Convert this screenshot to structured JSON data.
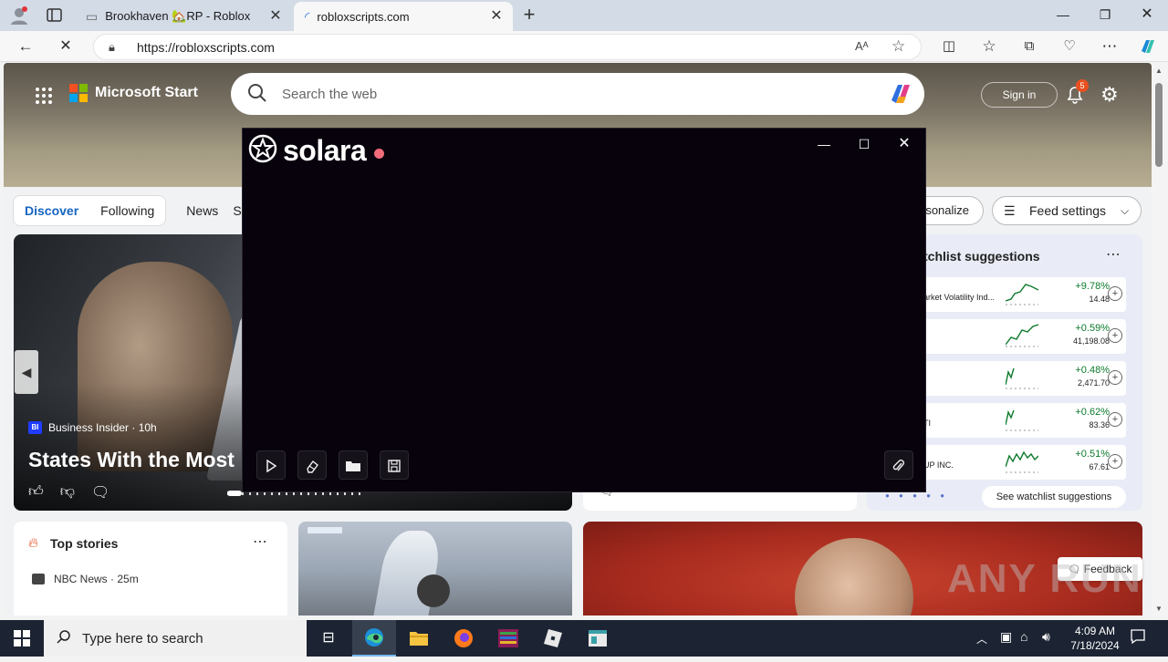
{
  "browser": {
    "tabs": [
      {
        "title": "Brookhaven 🏡RP - Roblox",
        "active": false
      },
      {
        "title": "robloxscripts.com",
        "active": true
      }
    ],
    "address": {
      "url": "https://robloxscripts.com"
    }
  },
  "page": {
    "brand": "Microsoft Start",
    "search_placeholder": "Search the web",
    "sign_in": "Sign in",
    "notification_count": "5",
    "nav": {
      "discover": "Discover",
      "following": "Following",
      "news": "News",
      "partial": "Sp",
      "personalize": "rsonalize",
      "feed_settings": "Feed settings"
    },
    "hero_card": {
      "source": "Business Insider · 10h",
      "source_badge": "BI",
      "headline": "States With the Most"
    },
    "watchlist": {
      "title": "tchlist suggestions",
      "rows": [
        {
          "name": "arket Volatility Ind...",
          "change": "+9.78%",
          "price": "14.48"
        },
        {
          "name": "",
          "change": "+0.59%",
          "price": "41,198.08"
        },
        {
          "name": "",
          "change": "+0.48%",
          "price": "2,471.70"
        },
        {
          "name": "TI",
          "change": "+0.62%",
          "price": "83.36"
        },
        {
          "name": "UP INC.",
          "change": "+0.51%",
          "price": "67.61"
        }
      ],
      "see_all": "See watchlist suggestions"
    },
    "top_stories": {
      "title": "Top stories",
      "first_source": "NBC News · 25m"
    },
    "feedback": "Feedback"
  },
  "solara": {
    "title": "solara",
    "status_color": "#f26b7b"
  },
  "taskbar": {
    "search_placeholder": "Type here to search",
    "time": "4:09 AM",
    "date": "7/18/2024"
  },
  "watermark": "ANY RUN",
  "colors": {
    "tabstrip": "#d3dbe6",
    "positive": "#0d7a2c",
    "taskbar": "#1c2433",
    "solara_bg": "#07020c"
  }
}
